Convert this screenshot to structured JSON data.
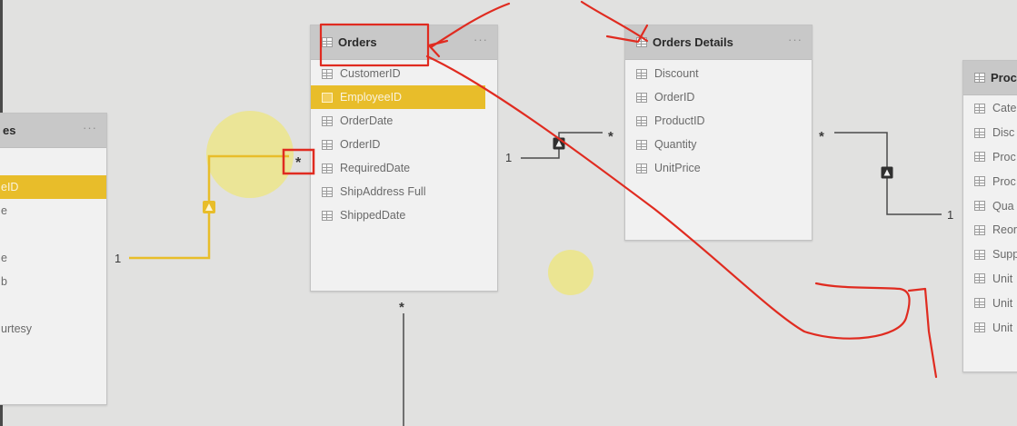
{
  "colors": {
    "canvas_bg": "#e1e1e0",
    "card_bg": "#f1f1f1",
    "card_header": "#c8c8c8",
    "highlight": "#e8bd2a",
    "annotation_red": "#e02b20"
  },
  "tables": {
    "employees": {
      "title": "es",
      "menu": "···",
      "fields": [
        "eID",
        "e",
        "",
        "e",
        "b",
        "",
        "urtesy"
      ],
      "selected_field": "eID"
    },
    "orders": {
      "title": "Orders",
      "menu": "···",
      "fields": [
        "CustomerID",
        "EmployeeID",
        "OrderDate",
        "OrderID",
        "RequiredDate",
        "ShipAddress Full",
        "ShippedDate"
      ],
      "selected_field": "EmployeeID"
    },
    "orders_details": {
      "title": "Orders Details",
      "menu": "···",
      "fields": [
        "Discount",
        "OrderID",
        "ProductID",
        "Quantity",
        "UnitPrice"
      ]
    },
    "products": {
      "title": "Proc",
      "fields": [
        "Cate",
        "Disc",
        "Proc",
        "Proc",
        "Qua",
        "Reor",
        "Supp",
        "Unit",
        "Unit",
        "Unit"
      ]
    }
  },
  "relationships": {
    "employees_orders": {
      "one": "1",
      "many": "*"
    },
    "orders_orders_details": {
      "one": "1",
      "many": "*"
    },
    "orders_details_products": {
      "many": "*",
      "one": "1"
    },
    "orders_down": {
      "many": "*"
    }
  }
}
